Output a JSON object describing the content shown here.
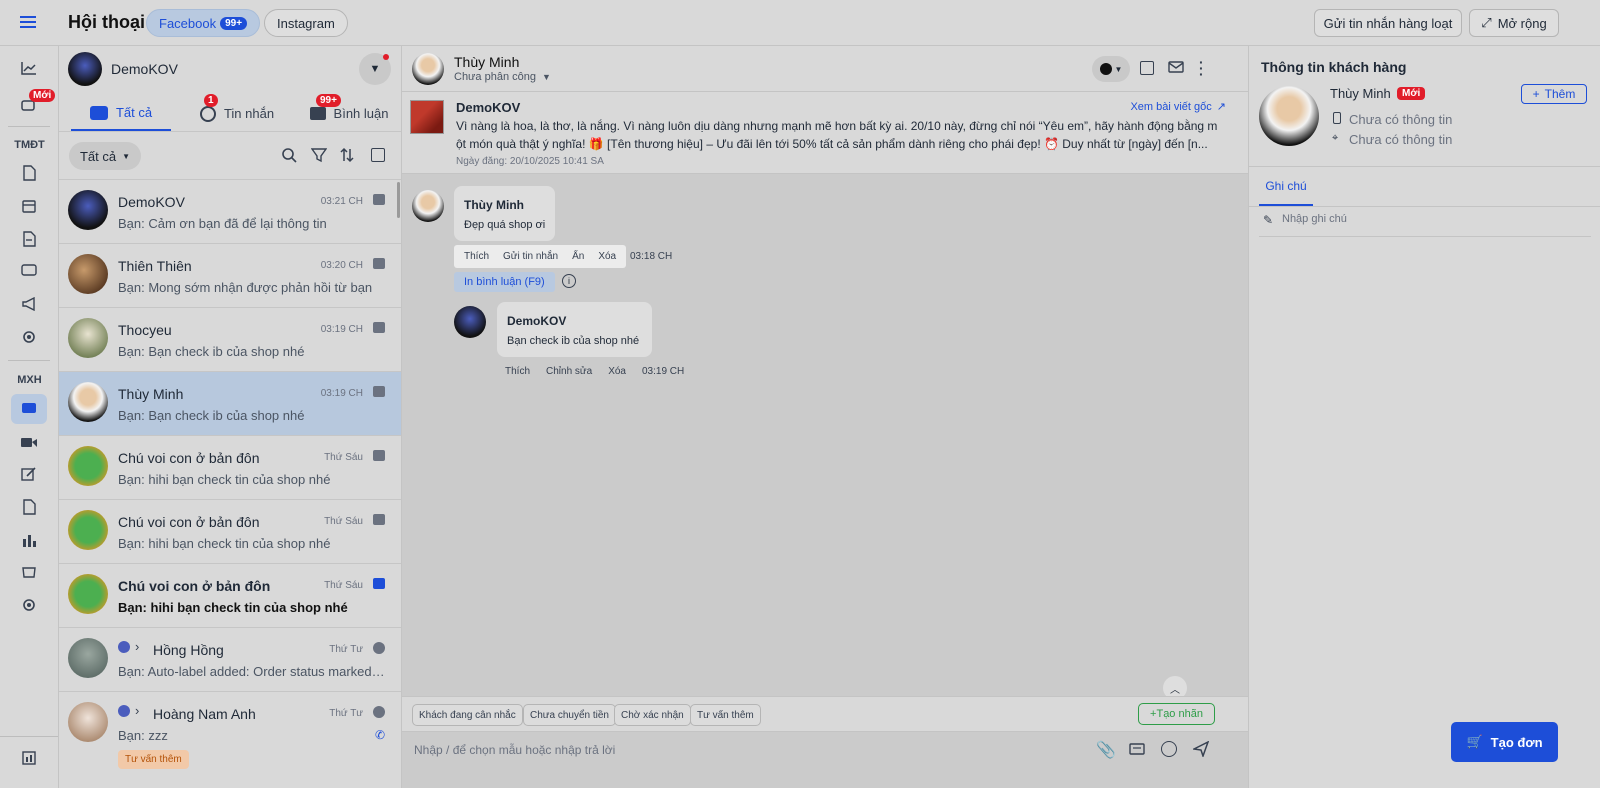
{
  "header": {
    "title": "Hội thoại",
    "tabs": [
      {
        "label": "Facebook",
        "badge": "99+",
        "active": true
      },
      {
        "label": "Instagram",
        "active": false
      }
    ],
    "bulk_send_label": "Gửi tin nhắn hàng loạt",
    "expand_label": "Mở rộng"
  },
  "leftnav": {
    "new_badge": "Mới",
    "section1": "TMĐT",
    "section2": "MXH"
  },
  "conversations": {
    "account_name": "DemoKOV",
    "tabs": [
      {
        "label": "Tất cả",
        "active": true
      },
      {
        "label": "Tin nhắn",
        "badge": "1"
      },
      {
        "label": "Bình luận",
        "badge": "99+"
      }
    ],
    "filter_label": "Tất cả",
    "items": [
      {
        "name": "DemoKOV",
        "time": "03:21 CH",
        "preview": "Bạn: Cảm ơn bạn đã để lại thông tin"
      },
      {
        "name": "Thiên Thiên",
        "time": "03:20 CH",
        "preview": "Bạn: Mong sớm nhận được phản hồi từ bạn"
      },
      {
        "name": "Thocyeu",
        "time": "03:19 CH",
        "preview": "Bạn: Bạn check ib của shop nhé"
      },
      {
        "name": "Thùy Minh",
        "time": "03:19 CH",
        "preview": "Bạn: Bạn check ib của shop nhé"
      },
      {
        "name": "Chú voi con ở bản đôn",
        "time": "Thứ Sáu",
        "preview": "Bạn: hihi bạn check tin của shop nhé"
      },
      {
        "name": "Chú voi con ở bản đôn",
        "time": "Thứ Sáu",
        "preview": "Bạn: hihi bạn check tin của shop nhé"
      },
      {
        "name": "Chú voi con ở bản đôn",
        "time": "Thứ Sáu",
        "preview": "Bạn: hihi bạn check tin của shop nhé"
      },
      {
        "name": "Hồng Hồng",
        "time": "Thứ Tư",
        "preview": "Bạn: Auto-label added: Order status marked as ..."
      },
      {
        "name": "Hoàng Nam Anh",
        "time": "Thứ Tư",
        "preview": "Bạn: zzz",
        "tag": "Tư vấn thêm"
      }
    ]
  },
  "chat": {
    "name": "Thùy Minh",
    "assign_status": "Chưa phân công",
    "post": {
      "author": "DemoKOV",
      "view_original": "Xem bài viết gốc",
      "line1": "Vì nàng là hoa, là thơ, là nắng. Vì nàng luôn dịu dàng nhưng mạnh mẽ hơn bất kỳ ai. 20/10 này, đừng chỉ nói “Yêu em”, hãy hành động bằng m",
      "line2": "ột món quà thật ý nghĩa! 🎁 [Tên thương hiệu] – Ưu đãi lên tới 50% tất cả sản phẩm dành riêng cho phái đẹp! ⏰ Duy nhất từ [ngày] đến [n...",
      "date": "Ngày đăng: 20/10/2025 10:41 SA"
    },
    "comment": {
      "author": "Thùy Minh",
      "text": "Đẹp quá shop ơi",
      "actions": [
        "Thích",
        "Gửi tin nhắn",
        "Ẩn",
        "Xóa"
      ],
      "time": "03:18 CH",
      "print_label": "In bình luận (F9)"
    },
    "reply": {
      "author": "DemoKOV",
      "text": "Bạn check ib của shop nhé",
      "actions": [
        "Thích",
        "Chỉnh sửa",
        "Xóa"
      ],
      "time": "03:19 CH"
    },
    "quick_tags": [
      "Khách đang cân nhắc",
      "Chưa chuyển tiền",
      "Chờ xác nhận",
      "Tư vấn thêm"
    ],
    "create_tag_label": "+Tạo nhãn",
    "input_placeholder": "Nhập / để chọn mẫu hoặc nhập trả lời"
  },
  "info": {
    "title": "Thông tin khách hàng",
    "name": "Thùy Minh",
    "new_badge": "Mới",
    "add_label": "Thêm",
    "phone": "Chưa có thông tin",
    "address": "Chưa có thông tin",
    "notes_tab": "Ghi chú",
    "note_placeholder": "Nhập ghi chú",
    "create_order_label": "Tạo đơn"
  },
  "colors": {
    "accent": "#1d4ed8",
    "badge_red": "#e11d2a",
    "selected_row": "#b7c8dd"
  }
}
